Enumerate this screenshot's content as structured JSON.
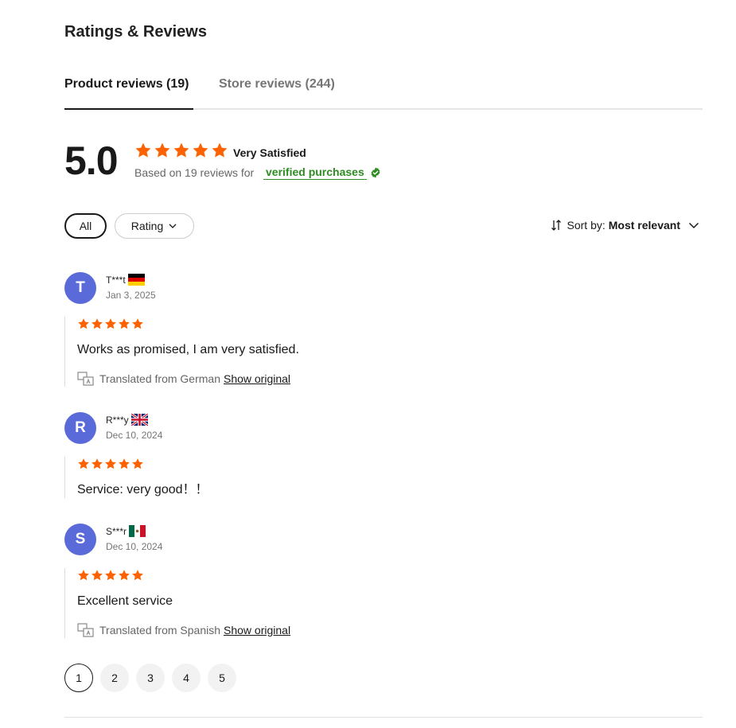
{
  "section_title": "Ratings & Reviews",
  "tabs": [
    {
      "label": "Product reviews (19)",
      "active": true
    },
    {
      "label": "Store reviews (244)",
      "active": false
    }
  ],
  "summary": {
    "score": "5.0",
    "stars": 5,
    "satisfaction": "Very Satisfied",
    "based_on": "Based on 19 reviews for",
    "verified": "verified purchases"
  },
  "filters": {
    "all": "All",
    "rating": "Rating"
  },
  "sort": {
    "label": "Sort by:",
    "value": "Most relevant"
  },
  "reviews": [
    {
      "initial": "T",
      "name": "T***t",
      "flag": "germany-flag-icon",
      "date": "Jan 3, 2025",
      "rating": 5,
      "text": "Works as promised, I am very satisfied.",
      "translated": "Translated from German",
      "show_original": "Show original"
    },
    {
      "initial": "R",
      "name": "R***y",
      "flag": "uk-flag-icon",
      "date": "Dec 10, 2024",
      "rating": 5,
      "text": "Service: very good！！"
    },
    {
      "initial": "S",
      "name": "S***r",
      "flag": "mexico-flag-icon",
      "date": "Dec 10, 2024",
      "rating": 5,
      "text": "Excellent service",
      "translated": "Translated from Spanish",
      "show_original": "Show original"
    }
  ],
  "pagination": {
    "pages": [
      "1",
      "2",
      "3",
      "4",
      "5"
    ],
    "current": "1"
  },
  "colors": {
    "star": "#fd6200",
    "avatar": "#5b6ad9",
    "verified": "#2e8b22",
    "text": "#191919"
  }
}
